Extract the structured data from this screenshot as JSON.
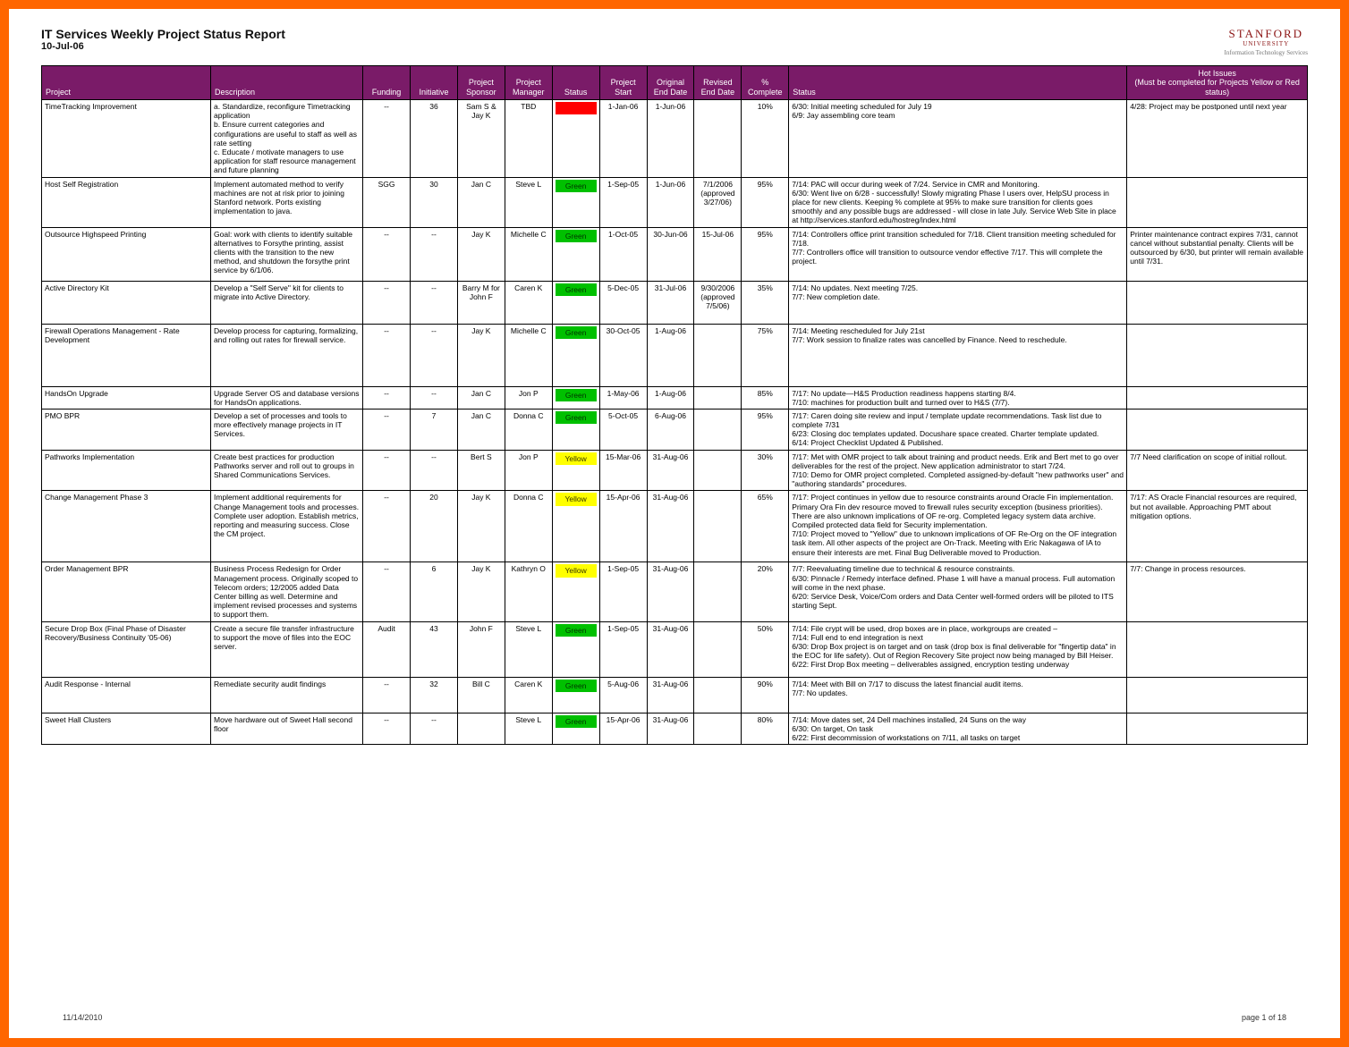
{
  "header": {
    "title": "IT Services Weekly Project Status Report",
    "report_date": "10-Jul-06",
    "brand_line1": "STANFORD",
    "brand_line2": "UNIVERSITY",
    "brand_line3": "Information Technology Services"
  },
  "columns": [
    "Project",
    "Description",
    "Funding",
    "Initiative",
    "Project Sponsor",
    "Project Manager",
    "Status",
    "Project Start",
    "Original End Date",
    "Revised End Date",
    "% Complete",
    "Status",
    "Hot Issues\n(Must be completed for Projects Yellow or Red status)"
  ],
  "rows": [
    {
      "project": "TimeTracking Improvement",
      "description": "a. Standardize, reconfigure Timetracking application\nb. Ensure current categories and configurations are useful to staff as well as rate setting\nc. Educate / motivate managers to use application for staff resource management and future planning",
      "funding": "--",
      "initiative": "36",
      "sponsor": "Sam S & Jay K",
      "pm": "TBD",
      "status_color": "Red",
      "status_label": "Red",
      "start": "1-Jan-06",
      "orig_end": "1-Jun-06",
      "rev_end": "",
      "pct": "10%",
      "status_text": "6/30: Initial meeting scheduled for July 19\n6/9: Jay assembling core team",
      "hot": "4/28: Project may be postponed until next year"
    },
    {
      "project": "Host Self Registration",
      "description": "Implement automated method to verify machines are not at risk prior to joining Stanford network. Ports existing implementation to java.",
      "funding": "SGG",
      "initiative": "30",
      "sponsor": "Jan C",
      "pm": "Steve L",
      "status_color": "Green",
      "status_label": "Green",
      "start": "1-Sep-05",
      "orig_end": "1-Jun-06",
      "rev_end": "7/1/2006\n(approved 3/27/06)",
      "pct": "95%",
      "status_text": "7/14: PAC will occur during week of 7/24. Service in CMR and Monitoring.\n6/30: Went live on 6/28 - successfully! Slowly migrating Phase I users over, HelpSU process in place for new clients. Keeping % complete at 95% to make sure transition for clients goes smoothly and any possible bugs are addressed - will close in late July. Service Web Site in place at http://services.stanford.edu/hostreg/index.html",
      "hot": ""
    },
    {
      "project": "Outsource Highspeed Printing",
      "description": "Goal: work with clients to identify suitable alternatives to Forsythe printing, assist clients with the transition to the new method, and shutdown the forsythe print service by 6/1/06.",
      "funding": "--",
      "initiative": "--",
      "sponsor": "Jay K",
      "pm": "Michelle C",
      "status_color": "Green",
      "status_label": "Green",
      "start": "1-Oct-05",
      "orig_end": "30-Jun-06",
      "rev_end": "15-Jul-06",
      "pct": "95%",
      "status_text": "7/14: Controllers office print transition scheduled for 7/18. Client transition meeting scheduled for 7/18.\n7/7: Controllers office will transition to outsource vendor effective 7/17. This will complete the project.",
      "hot": "Printer maintenance contract expires 7/31, cannot cancel without substantial penalty. Clients will be outsourced by 6/30, but printer will remain available until 7/31."
    },
    {
      "project": "Active Directory Kit",
      "description": "Develop a \"Self Serve\" kit for clients to migrate into Active Directory.",
      "funding": "--",
      "initiative": "--",
      "sponsor": "Barry M for John F",
      "pm": "Caren K",
      "status_color": "Green",
      "status_label": "Green",
      "start": "5-Dec-05",
      "orig_end": "31-Jul-06",
      "rev_end": "9/30/2006\n(approved 7/5/06)",
      "pct": "35%",
      "status_text": "7/14: No updates. Next meeting 7/25.\n7/7: New completion date.",
      "hot": ""
    },
    {
      "project": "Firewall Operations Management - Rate Development",
      "description": "Develop process for capturing, formalizing, and rolling out rates for firewall service.",
      "funding": "--",
      "initiative": "--",
      "sponsor": "Jay K",
      "pm": "Michelle C",
      "status_color": "Green",
      "status_label": "Green",
      "start": "30-Oct-05",
      "orig_end": "1-Aug-06",
      "rev_end": "",
      "pct": "75%",
      "status_text": "7/14: Meeting rescheduled for July 21st\n7/7: Work session to finalize rates was cancelled by Finance. Need to reschedule.",
      "hot": ""
    },
    {
      "project": "HandsOn Upgrade",
      "description": "Upgrade Server OS and database versions for HandsOn applications.",
      "funding": "--",
      "initiative": "--",
      "sponsor": "Jan C",
      "pm": "Jon P",
      "status_color": "Green",
      "status_label": "Green",
      "start": "1-May-06",
      "orig_end": "1-Aug-06",
      "rev_end": "",
      "pct": "85%",
      "status_text": "7/17: No update—H&S Production readiness happens starting 8/4.\n7/10: machines for production built and turned over to H&S (7/7).",
      "hot": ""
    },
    {
      "project": "PMO BPR",
      "description": "Develop a set of processes and tools to more effectively manage projects in IT Services.",
      "funding": "--",
      "initiative": "7",
      "sponsor": "Jan C",
      "pm": "Donna C",
      "status_color": "Green",
      "status_label": "Green",
      "start": "5-Oct-05",
      "orig_end": "6-Aug-06",
      "rev_end": "",
      "pct": "95%",
      "status_text": "7/17: Caren doing site review and input / template update recommendations. Task list due to complete 7/31\n6/23: Closing doc templates updated. Docushare space created. Charter template updated.\n6/14: Project Checklist Updated & Published.",
      "hot": ""
    },
    {
      "project": "Pathworks Implementation",
      "description": "Create best practices for production Pathworks server and roll out to groups in Shared Communications Services.",
      "funding": "--",
      "initiative": "--",
      "sponsor": "Bert S",
      "pm": "Jon P",
      "status_color": "Yellow",
      "status_label": "Yellow",
      "start": "15-Mar-06",
      "orig_end": "31-Aug-06",
      "rev_end": "",
      "pct": "30%",
      "status_text": "7/17: Met with OMR project to talk about training and product needs. Erik and Bert met to go over deliverables for the rest of the project. New application administrator to start 7/24.\n7/10: Demo for OMR project completed. Completed assigned-by-default \"new pathworks user\" and \"authoring standards\" procedures.",
      "hot": "7/7 Need clarification on scope of initial rollout."
    },
    {
      "project": "Change Management Phase 3",
      "description": "Implement additional requirements for Change Management tools and processes. Complete user adoption. Establish metrics, reporting and measuring success. Close the CM project.",
      "funding": "--",
      "initiative": "20",
      "sponsor": "Jay K",
      "pm": "Donna C",
      "status_color": "Yellow",
      "status_label": "Yellow",
      "start": "15-Apr-06",
      "orig_end": "31-Aug-06",
      "rev_end": "",
      "pct": "65%",
      "status_text": "7/17: Project continues in yellow due to resource constraints around Oracle Fin implementation. Primary Ora Fin dev resource moved to firewall rules security exception (business priorities). There are also unknown implications of OF re-org. Completed legacy system data archive. Compiled protected data field for Security implementation.\n7/10: Project moved to \"Yellow\" due to unknown implications of OF Re-Org on the OF integration task item. All other aspects of the project are On-Track. Meeting with Eric Nakagawa of IA to ensure their interests are met. Final Bug Deliverable moved to Production.",
      "hot": "7/17: AS Oracle Financial resources are required, but not available. Approaching PMT about mitigation options."
    },
    {
      "project": "Order Management BPR",
      "description": "Business Process Redesign for Order Management process. Originally scoped to Telecom orders; 12/2005 added Data Center billing as well. Determine and implement revised processes and systems to support them.",
      "funding": "--",
      "initiative": "6",
      "sponsor": "Jay K",
      "pm": "Kathryn O",
      "status_color": "Yellow",
      "status_label": "Yellow",
      "start": "1-Sep-05",
      "orig_end": "31-Aug-06",
      "rev_end": "",
      "pct": "20%",
      "status_text": "7/7: Reevaluating timeline due to technical & resource constraints.\n6/30: Pinnacle / Remedy interface defined. Phase 1 will have a manual process. Full automation will come in the next phase.\n6/20: Service Desk, Voice/Com orders and Data Center well-formed orders will be piloted to ITS starting Sept.",
      "hot": "7/7: Change in process resources."
    },
    {
      "project": "Secure Drop Box (Final Phase of Disaster Recovery/Business Continuity '05-06)",
      "description": "Create a secure file transfer infrastructure to support the move of files into the EOC server.",
      "funding": "Audit",
      "initiative": "43",
      "sponsor": "John F",
      "pm": "Steve L",
      "status_color": "Green",
      "status_label": "Green",
      "start": "1-Sep-05",
      "orig_end": "31-Aug-06",
      "rev_end": "",
      "pct": "50%",
      "status_text": "7/14: File crypt will be used, drop boxes are in place, workgroups are created –\n7/14: Full end to end integration is next\n6/30: Drop Box project is on target and on task (drop box is final deliverable for \"fingertip data\" in the EOC for life safety). Out of Region Recovery Site project now being managed by Bill Heiser.\n6/22: First Drop Box meeting – deliverables assigned, encryption testing underway",
      "hot": ""
    },
    {
      "project": "Audit Response - Internal",
      "description": "Remediate security audit findings",
      "funding": "--",
      "initiative": "32",
      "sponsor": "Bill C",
      "pm": "Caren K",
      "status_color": "Green",
      "status_label": "Green",
      "start": "5-Aug-06",
      "orig_end": "31-Aug-06",
      "rev_end": "",
      "pct": "90%",
      "status_text": "7/14: Meet with Bill on 7/17 to discuss the latest financial audit items.\n7/7: No updates.",
      "hot": ""
    },
    {
      "project": "Sweet Hall Clusters",
      "description": "Move hardware out of Sweet Hall second floor",
      "funding": "--",
      "initiative": "--",
      "sponsor": "",
      "pm": "Steve L",
      "status_color": "Green",
      "status_label": "Green",
      "start": "15-Apr-06",
      "orig_end": "31-Aug-06",
      "rev_end": "",
      "pct": "80%",
      "status_text": "7/14: Move dates set, 24 Dell machines installed, 24 Suns on the way\n6/30: On target, On task\n6/22: First decommission of workstations on 7/11, all tasks on target",
      "hot": ""
    }
  ],
  "footer": {
    "left": "11/14/2010",
    "right": "page 1 of 18"
  }
}
